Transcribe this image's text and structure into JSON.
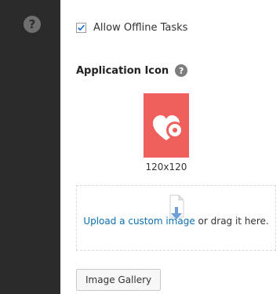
{
  "offline": {
    "checked": true,
    "label": "Allow Offline Tasks"
  },
  "app_icon": {
    "title": "Application Icon",
    "size_label": "120x120",
    "color": "#ef5f5b"
  },
  "upload": {
    "link_text": "Upload a custom image",
    "suffix_text": " or drag it here."
  },
  "gallery": {
    "button_label": "Image Gallery"
  },
  "icons": {
    "help_sidebar": "help-circle-icon",
    "help_small": "help-circle-icon",
    "upload": "file-upload-icon"
  }
}
